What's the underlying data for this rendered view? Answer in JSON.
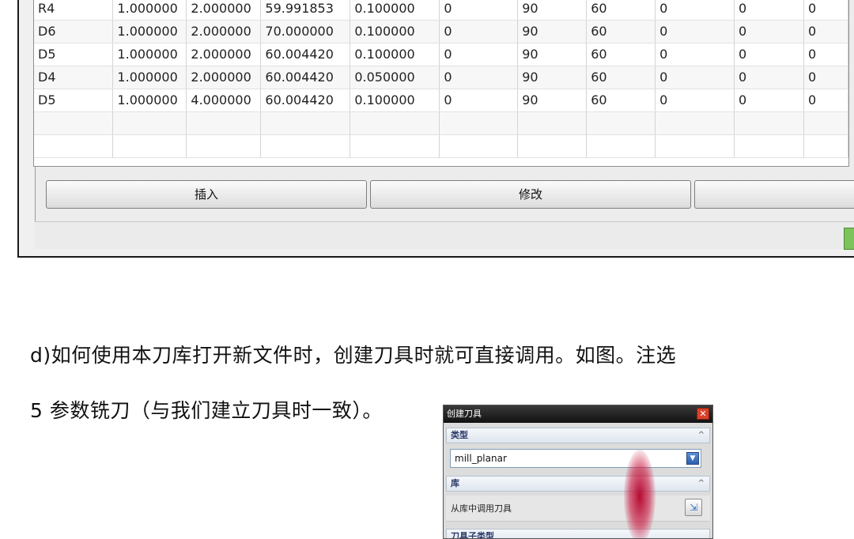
{
  "tool_table": {
    "rows": [
      [
        "R4",
        "1.000000",
        "2.000000",
        "59.991853",
        "0.100000",
        "0",
        "90",
        "60",
        "0",
        "0",
        "0"
      ],
      [
        "D6",
        "1.000000",
        "2.000000",
        "70.000000",
        "0.100000",
        "0",
        "90",
        "60",
        "0",
        "0",
        "0"
      ],
      [
        "D5",
        "1.000000",
        "2.000000",
        "60.004420",
        "0.100000",
        "0",
        "90",
        "60",
        "0",
        "0",
        "0"
      ],
      [
        "D4",
        "1.000000",
        "2.000000",
        "60.004420",
        "0.050000",
        "0",
        "90",
        "60",
        "0",
        "0",
        "0"
      ],
      [
        "D5",
        "1.000000",
        "4.000000",
        "60.004420",
        "0.100000",
        "0",
        "90",
        "60",
        "0",
        "0",
        "0"
      ]
    ],
    "empty_rows": 2
  },
  "buttons": {
    "insert": "插入",
    "modify": "修改",
    "third": ""
  },
  "paragraph": {
    "line1": "d)如何使用本刀库打开新文件时，创建刀具时就可直接调用。如图。注选",
    "line2": "5 参数铣刀（与我们建立刀具时一致）。"
  },
  "create_tool_dialog": {
    "title": "创建刀具",
    "close": "✕",
    "type_section": "类型",
    "type_value": "mill_planar",
    "library_section": "库",
    "library_action": "从库中调用刀具",
    "next_section": "刀具子类型",
    "caret_up": "^"
  }
}
